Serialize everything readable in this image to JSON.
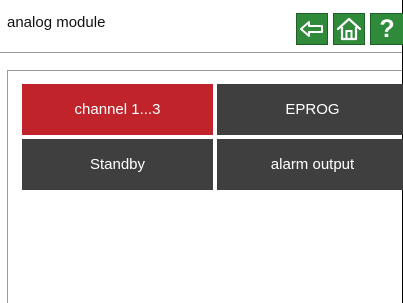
{
  "header": {
    "title": "analog module",
    "help_label": "?"
  },
  "tiles": [
    {
      "label": "channel 1...3",
      "state": "active",
      "color": "#c0232a"
    },
    {
      "label": "EPROG",
      "state": "inactive",
      "color": "#3f3f3f"
    },
    {
      "label": "Standby",
      "state": "inactive",
      "color": "#3f3f3f"
    },
    {
      "label": "alarm output",
      "state": "inactive",
      "color": "#3f3f3f"
    }
  ],
  "colors": {
    "nav_button": "#2f8a3a",
    "active_tile": "#c0232a",
    "inactive_tile": "#3f3f3f"
  },
  "icons": {
    "back": "back-arrow-icon",
    "home": "home-icon",
    "help": "question-mark-icon"
  }
}
